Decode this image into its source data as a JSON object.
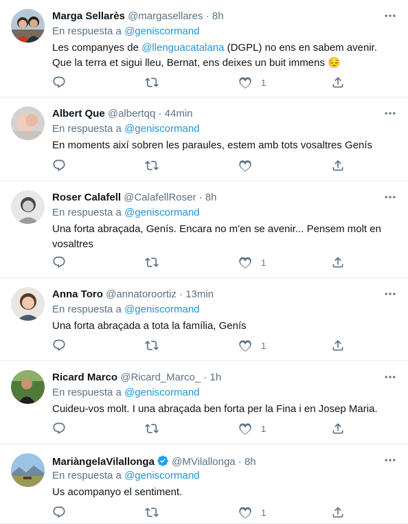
{
  "reply_prefix": "En respuesta a",
  "tweets": [
    {
      "name": "Marga Sellarès",
      "handle": "@margasellares",
      "time": "8h",
      "reply_to": "@geniscormand",
      "text_parts": [
        {
          "t": "Les companyes de ",
          "m": false
        },
        {
          "t": "@llenguacatalana",
          "m": true
        },
        {
          "t": " (DGPL) no ens en sabem avenir. Que la terra et sigui lleu, Bernat, ens deixes un buit immens 😔",
          "m": false
        }
      ],
      "likes": "1",
      "verified": false
    },
    {
      "name": "Albert Que",
      "handle": "@albertqq",
      "time": "44min",
      "reply_to": "@geniscormand",
      "text_parts": [
        {
          "t": "En moments així sobren les paraules, estem amb tots vosaltres Genís",
          "m": false
        }
      ],
      "likes": "",
      "verified": false
    },
    {
      "name": "Roser Calafell",
      "handle": "@CalafellRoser",
      "time": "8h",
      "reply_to": "@geniscormand",
      "text_parts": [
        {
          "t": "Una forta abraçada, Genís. Encara no m'en se avenir... Pensem molt en vosaltres",
          "m": false
        }
      ],
      "likes": "1",
      "verified": false
    },
    {
      "name": "Anna Toro",
      "handle": "@annatoroortiz",
      "time": "13min",
      "reply_to": "@geniscormand",
      "text_parts": [
        {
          "t": "Una forta abraçada a tota la família, Genís",
          "m": false
        }
      ],
      "likes": "1",
      "verified": false
    },
    {
      "name": "Ricard Marco",
      "handle": "@Ricard_Marco_",
      "time": "1h",
      "reply_to": "@geniscormand",
      "text_parts": [
        {
          "t": "Cuideu-vos molt. I una abraçada ben forta per la Fina i en Josep Maria.",
          "m": false
        }
      ],
      "likes": "1",
      "verified": false
    },
    {
      "name": "MariàngelaVilallonga",
      "handle": "@MVilallonga",
      "time": "8h",
      "reply_to": "@geniscormand",
      "text_parts": [
        {
          "t": "Us acompanyo el sentiment.",
          "m": false
        }
      ],
      "likes": "1",
      "verified": true
    }
  ],
  "colors": {
    "text": "#0f1419",
    "secondary": "#5b7083",
    "link": "#1b95e0",
    "verified": "#1da1f2",
    "border": "#e6ecf0"
  },
  "icons": {
    "reply": "reply-icon",
    "retweet": "retweet-icon",
    "like": "heart-icon",
    "share": "share-icon",
    "more": "more-icon",
    "verified": "verified-badge-icon"
  }
}
